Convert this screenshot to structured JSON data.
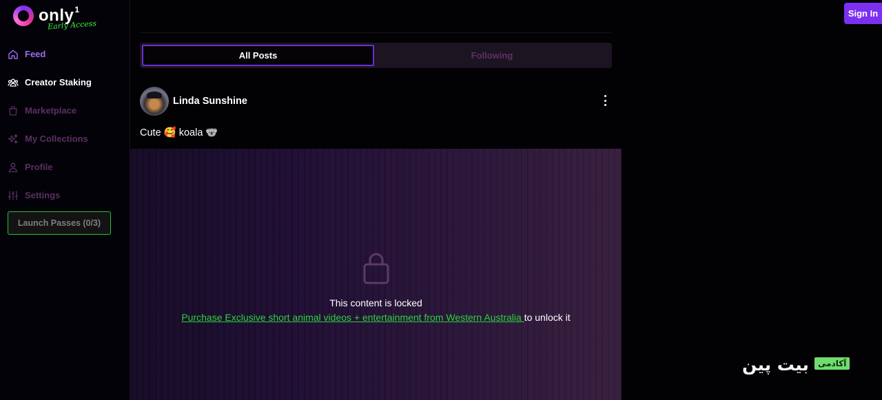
{
  "app": {
    "logo_text": "only",
    "logo_sup": "1",
    "logo_tagline": "Early Access"
  },
  "sidebar": {
    "items": [
      {
        "label": "Feed",
        "icon": "home-icon",
        "state": "active"
      },
      {
        "label": "Creator Staking",
        "icon": "users-icon",
        "state": "enabled"
      },
      {
        "label": "Marketplace",
        "icon": "shopping-bag-icon",
        "state": "dim"
      },
      {
        "label": "My Collections",
        "icon": "sparkles-icon",
        "state": "dim"
      },
      {
        "label": "Profile",
        "icon": "user-icon",
        "state": "dim"
      },
      {
        "label": "Settings",
        "icon": "sliders-icon",
        "state": "dim"
      }
    ],
    "launch_passes_label": "Launch Passes (0/3)"
  },
  "header": {
    "sign_in_label": "Sign In"
  },
  "feed": {
    "tabs": [
      {
        "label": "All Posts",
        "selected": true
      },
      {
        "label": "Following",
        "selected": false
      }
    ],
    "post": {
      "author": "Linda Sunshine",
      "caption": "Cute 🥰 koala 🐨",
      "locked_message": "This content is locked",
      "purchase_link": "Purchase Exclusive short animal videos + entertainment from Western Australia ",
      "unlock_suffix": "to unlock it"
    }
  },
  "watermark": {
    "brand": "بیت پین",
    "tag": "آکادمی"
  },
  "colors": {
    "accent": "#7b30f0",
    "active_nav": "#9b6cf0",
    "link_green": "#29d43a",
    "dim_nav": "#5a2f62"
  }
}
